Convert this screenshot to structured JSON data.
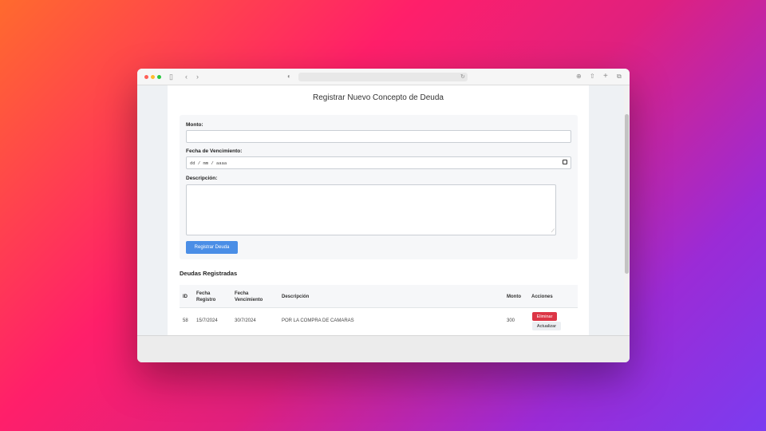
{
  "colors": {
    "close": "#ff5f57",
    "minimize": "#febc2e",
    "maximize": "#28c840",
    "primary": "#4a8ee6",
    "danger": "#dc3545"
  },
  "browser": {
    "sidebar_icon": "sidebar-icon",
    "back_icon": "chevron-left-icon",
    "forward_icon": "chevron-right-icon",
    "shield_icon": "shield-icon",
    "reload_icon": "reload-icon",
    "download_icon": "download-icon",
    "share_icon": "share-icon",
    "new_tab_icon": "plus-icon",
    "tabs_icon": "tabs-icon"
  },
  "page": {
    "title": "Registrar Nuevo Concepto de Deuda",
    "form": {
      "monto_label": "Monto:",
      "monto_value": "",
      "fecha_label": "Fecha de Vencimiento:",
      "fecha_placeholder": "dd / mm / aaaa",
      "descripcion_label": "Descripción:",
      "descripcion_value": "",
      "submit_label": "Registrar Deuda"
    },
    "table": {
      "title": "Deudas Registradas",
      "headers": {
        "id": "ID",
        "fecha_registro_1": "Fecha",
        "fecha_registro_2": "Registro",
        "fecha_venc_1": "Fecha",
        "fecha_venc_2": "Vencimiento",
        "descripcion": "Descripción",
        "monto": "Monto",
        "acciones": "Acciones"
      },
      "rows": [
        {
          "id": "58",
          "fecha_registro": "15/7/2024",
          "fecha_vencimiento": "30/7/2024",
          "descripcion": "POR LA COMPRA DE CAMARAS",
          "monto": "300",
          "delete_label": "Eliminar",
          "update_label": "Actualizar"
        }
      ]
    }
  }
}
